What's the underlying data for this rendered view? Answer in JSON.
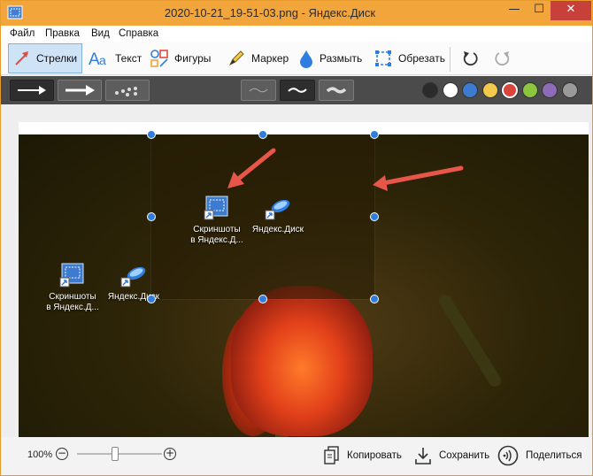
{
  "window": {
    "title": "2020-10-21_19-51-03.png - Яндекс.Диск",
    "minimize_glyph": "—",
    "maximize_glyph": "☐",
    "close_glyph": "✕"
  },
  "menu": [
    "Файл",
    "Правка",
    "Вид",
    "Справка"
  ],
  "toolbar": {
    "tools": [
      {
        "label": "Стрелки",
        "icon": "arrow-icon",
        "active": true
      },
      {
        "label": "Текст",
        "icon": "text-icon",
        "active": false
      },
      {
        "label": "Фигуры",
        "icon": "shapes-icon",
        "active": false
      },
      {
        "label": "Маркер",
        "icon": "marker-icon",
        "active": false
      },
      {
        "label": "Размыть",
        "icon": "blur-drop-icon",
        "active": false
      },
      {
        "label": "Обрезать",
        "icon": "crop-icon",
        "active": false
      }
    ],
    "undo_icon": "undo-icon",
    "redo_icon": "redo-icon"
  },
  "subtoolbar": {
    "arrow_styles": [
      "thin-arrow",
      "thick-arrow",
      "dotted-arrow"
    ],
    "selected_arrow_style": "thin-arrow",
    "line_widths": [
      "thin-wave",
      "medium-wave",
      "thick-wave"
    ],
    "selected_line_width": "medium-wave",
    "colors": [
      "#2b2b2b",
      "#ffffff",
      "#3d7bd1",
      "#f2c94c",
      "#d9443b",
      "#8cc63f",
      "#8e6bb8",
      "#9a9a9a"
    ],
    "selected_color": "#d9443b"
  },
  "desktop_icons": [
    {
      "line1": "Скриншоты",
      "line2": "в Яндекс.Д...",
      "icon": "screenshot-shortcut-icon"
    },
    {
      "line1": "Яндекс.Диск",
      "line2": "",
      "icon": "yandex-disk-shortcut-icon"
    },
    {
      "line1": "Скриншоты",
      "line2": "в Яндекс.Д...",
      "icon": "screenshot-shortcut-icon"
    },
    {
      "line1": "Яндекс.Диск",
      "line2": "",
      "icon": "yandex-disk-shortcut-icon"
    }
  ],
  "annotation_color": "#e8564a",
  "statusbar": {
    "zoom": "100%",
    "zoom_out": "−",
    "zoom_in": "+",
    "zoom_level": 0.45,
    "copy": "Копировать",
    "save": "Сохранить",
    "share": "Поделиться"
  }
}
